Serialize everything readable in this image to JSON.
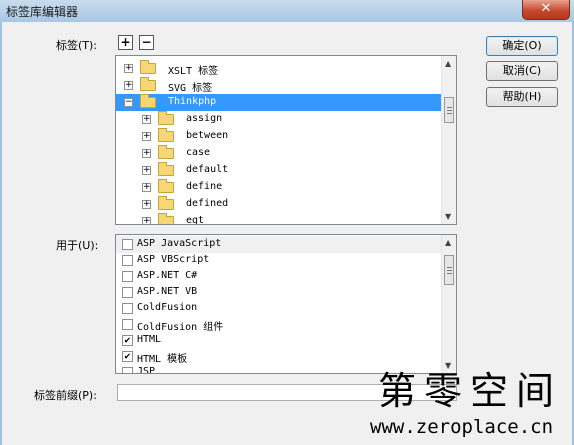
{
  "window": {
    "title": "标签库编辑器",
    "close_glyph": "✕"
  },
  "tags_label": "标签(T):",
  "add_glyph": "+",
  "remove_glyph": "−",
  "tree": [
    {
      "label": "XSLT 标签",
      "expander": "+",
      "level": 0,
      "selected": false
    },
    {
      "label": "SVG 标签",
      "expander": "+",
      "level": 0,
      "selected": false
    },
    {
      "label": "Thinkphp",
      "expander": "−",
      "level": 0,
      "selected": true
    },
    {
      "label": "assign",
      "expander": "+",
      "level": 1,
      "selected": false
    },
    {
      "label": "between",
      "expander": "+",
      "level": 1,
      "selected": false
    },
    {
      "label": "case",
      "expander": "+",
      "level": 1,
      "selected": false
    },
    {
      "label": "default",
      "expander": "+",
      "level": 1,
      "selected": false
    },
    {
      "label": "define",
      "expander": "+",
      "level": 1,
      "selected": false
    },
    {
      "label": "defined",
      "expander": "+",
      "level": 1,
      "selected": false
    },
    {
      "label": "egt",
      "expander": "+",
      "level": 1,
      "selected": false
    }
  ],
  "used_for_label": "用于(U):",
  "used_for": [
    {
      "label": "ASP JavaScript",
      "checked": false
    },
    {
      "label": "ASP VBScript",
      "checked": false
    },
    {
      "label": "ASP.NET C#",
      "checked": false
    },
    {
      "label": "ASP.NET VB",
      "checked": false
    },
    {
      "label": "ColdFusion",
      "checked": false
    },
    {
      "label": "ColdFusion 组件",
      "checked": false
    },
    {
      "label": "HTML",
      "checked": true
    },
    {
      "label": "HTML 模板",
      "checked": true
    },
    {
      "label": "JSP",
      "checked": false
    }
  ],
  "check_glyph": "✔",
  "prefix_label": "标签前缀(P):",
  "prefix_value": "",
  "buttons": {
    "ok": "确定(O)",
    "cancel": "取消(C)",
    "help": "帮助(H)"
  },
  "watermark": {
    "text": "第零空间",
    "url": "www.zeroplace.cn"
  },
  "scroll_arrows": {
    "up": "▲",
    "down": "▼"
  }
}
